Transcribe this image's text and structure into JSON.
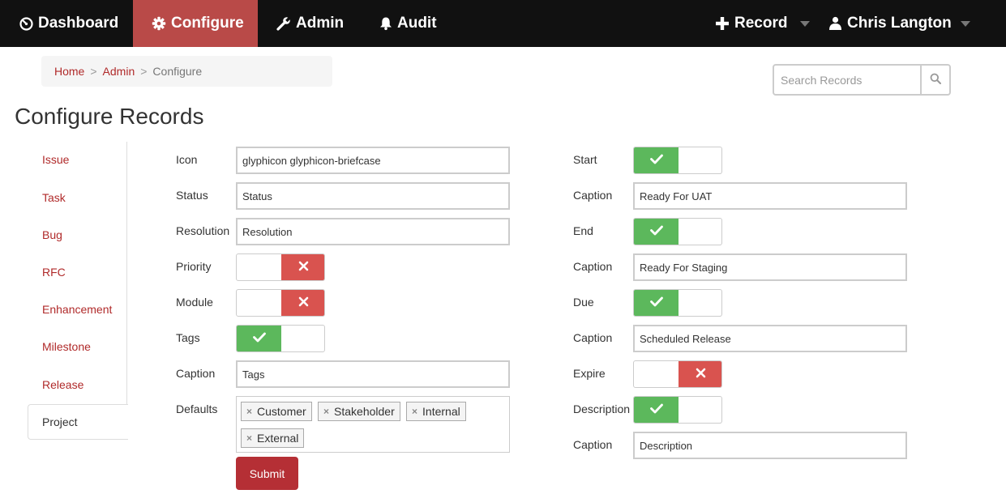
{
  "nav": {
    "dashboard": "Dashboard",
    "configure": "Configure",
    "admin": "Admin",
    "audit": "Audit",
    "record": "Record",
    "user": "Chris Langton"
  },
  "breadcrumb": {
    "home": "Home",
    "admin": "Admin",
    "current": "Configure",
    "separator": ">"
  },
  "search": {
    "placeholder": "Search Records"
  },
  "page_title": "Configure Records",
  "sidebar": {
    "items": [
      "Issue",
      "Task",
      "Bug",
      "RFC",
      "Enhancement",
      "Milestone",
      "Release",
      "Project"
    ],
    "active": "Project"
  },
  "form_left": {
    "icon_label": "Icon",
    "icon_value": "glyphicon glyphicon-briefcase",
    "status_label": "Status",
    "status_value": "Status",
    "resolution_label": "Resolution",
    "resolution_value": "Resolution",
    "priority_label": "Priority",
    "priority_on": false,
    "module_label": "Module",
    "module_on": false,
    "tags_label": "Tags",
    "tags_on": true,
    "caption_label": "Caption",
    "caption_value": "Tags",
    "defaults_label": "Defaults",
    "defaults": [
      "Customer",
      "Stakeholder",
      "Internal",
      "External"
    ],
    "submit": "Submit"
  },
  "form_right": {
    "start_label": "Start",
    "start_on": true,
    "start_caption_label": "Caption",
    "start_caption_value": "Ready For UAT",
    "end_label": "End",
    "end_on": true,
    "end_caption_label": "Caption",
    "end_caption_value": "Ready For Staging",
    "due_label": "Due",
    "due_on": true,
    "due_caption_label": "Caption",
    "due_caption_value": "Scheduled Release",
    "expire_label": "Expire",
    "expire_on": false,
    "description_label": "Description",
    "description_on": true,
    "description_caption_label": "Caption",
    "description_caption_value": "Description"
  },
  "colors": {
    "navbar": "#111111",
    "active_nav": "#b94a48",
    "link": "#b02a2a",
    "switch_on": "#5cb85c",
    "switch_off": "#d9534f",
    "submit": "#b52f35"
  },
  "icons": {
    "dashboard": "dashboard-gauge-icon",
    "configure": "gear-icon",
    "admin": "wrench-icon",
    "audit": "bell-icon",
    "record": "plus-icon",
    "user": "user-icon",
    "search": "search-icon",
    "switch_on": "check-icon",
    "switch_off": "x-icon",
    "tag_remove": "remove-x-icon"
  }
}
